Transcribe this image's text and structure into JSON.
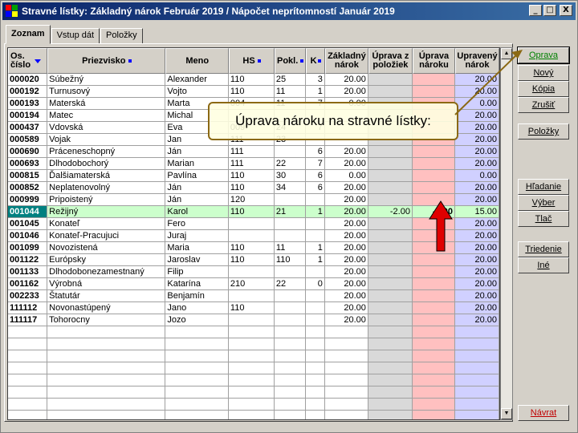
{
  "window": {
    "title": "Stravné lístky:  Základný nárok Február 2019  /  Nápočet neprítomností Január 2019",
    "min_label": "_",
    "max_label": "□",
    "close_label": "X"
  },
  "tabs": [
    {
      "label": "Zoznam",
      "active": true
    },
    {
      "label": "Vstup dát",
      "active": false
    },
    {
      "label": "Položky",
      "active": false
    }
  ],
  "columns": {
    "os_cislo": "Os. číslo",
    "priezvisko": "Priezvisko",
    "meno": "Meno",
    "hs": "HS",
    "pokl": "Pokl.",
    "k": "K",
    "zakladny_narok": "Základný nárok",
    "uprava_z_poloziek": "Úprava z položiek",
    "uprava_naroku": "Úprava nároku",
    "upraveny_narok": "Upravený nárok"
  },
  "rows": [
    {
      "code": "000020",
      "surname": "Súbežný",
      "name": "Alexander",
      "hs": "110",
      "pokl": "25",
      "k": "3",
      "base": "20.00",
      "adj_items": "",
      "adj": "",
      "final": "20.00"
    },
    {
      "code": "000192",
      "surname": "Turnusový",
      "name": "Vojto",
      "hs": "110",
      "pokl": "11",
      "k": "1",
      "base": "20.00",
      "adj_items": "",
      "adj": "",
      "final": "20.00"
    },
    {
      "code": "000193",
      "surname": "Materská",
      "name": "Marta",
      "hs": "004",
      "pokl": "11",
      "k": "7",
      "base": "0.00",
      "adj_items": "",
      "adj": "",
      "final": "0.00"
    },
    {
      "code": "000194",
      "surname": "Matec",
      "name": "Michal",
      "hs": "",
      "pokl": "",
      "k": "",
      "base": "",
      "adj_items": "",
      "adj": "",
      "final": "20.00"
    },
    {
      "code": "000437",
      "surname": "Vdovská",
      "name": "Eva",
      "hs": "009",
      "pokl": "24",
      "k": "7",
      "base": "",
      "adj_items": "",
      "adj": "",
      "final": "20.00"
    },
    {
      "code": "000589",
      "surname": "Vojak",
      "name": "Jan",
      "hs": "111",
      "pokl": "23",
      "k": "",
      "base": "",
      "adj_items": "",
      "adj": "",
      "final": "20.00"
    },
    {
      "code": "000690",
      "surname": "Práceneschopný",
      "name": "Ján",
      "hs": "111",
      "pokl": "",
      "k": "6",
      "base": "20.00",
      "adj_items": "",
      "adj": "",
      "final": "20.00"
    },
    {
      "code": "000693",
      "surname": "Dlhodobochorý",
      "name": "Marian",
      "hs": "111",
      "pokl": "22",
      "k": "7",
      "base": "20.00",
      "adj_items": "",
      "adj": "",
      "final": "20.00"
    },
    {
      "code": "000815",
      "surname": "Ďalšiamaterská",
      "name": "Pavlína",
      "hs": "110",
      "pokl": "30",
      "k": "6",
      "base": "0.00",
      "adj_items": "",
      "adj": "",
      "final": "0.00"
    },
    {
      "code": "000852",
      "surname": "Neplatenovolný",
      "name": "Ján",
      "hs": "110",
      "pokl": "34",
      "k": "6",
      "base": "20.00",
      "adj_items": "",
      "adj": "",
      "final": "20.00"
    },
    {
      "code": "000999",
      "surname": "Pripoistený",
      "name": "Ján",
      "hs": "120",
      "pokl": "",
      "k": "",
      "base": "20.00",
      "adj_items": "",
      "adj": "",
      "final": "20.00"
    },
    {
      "code": "001044",
      "surname": "Režijný",
      "name": "Karol",
      "hs": "110",
      "pokl": "21",
      "k": "1",
      "base": "20.00",
      "adj_items": "-2.00",
      "adj": "-3.00",
      "final": "15.00",
      "selected": true
    },
    {
      "code": "001045",
      "surname": "Konateľ",
      "name": "Fero",
      "hs": "",
      "pokl": "",
      "k": "",
      "base": "20.00",
      "adj_items": "",
      "adj": "",
      "final": "20.00"
    },
    {
      "code": "001046",
      "surname": "Konateľ-Pracujuci",
      "name": "Juraj",
      "hs": "",
      "pokl": "",
      "k": "",
      "base": "20.00",
      "adj_items": "",
      "adj": "",
      "final": "20.00"
    },
    {
      "code": "001099",
      "surname": "Novozistená",
      "name": "Maria",
      "hs": "110",
      "pokl": "11",
      "k": "1",
      "base": "20.00",
      "adj_items": "",
      "adj": "",
      "final": "20.00"
    },
    {
      "code": "001122",
      "surname": "Európsky",
      "name": "Jaroslav",
      "hs": "110",
      "pokl": "110",
      "k": "1",
      "base": "20.00",
      "adj_items": "",
      "adj": "",
      "final": "20.00"
    },
    {
      "code": "001133",
      "surname": "Dlhodobonezamestnaný",
      "name": "Filip",
      "hs": "",
      "pokl": "",
      "k": "",
      "base": "20.00",
      "adj_items": "",
      "adj": "",
      "final": "20.00"
    },
    {
      "code": "001162",
      "surname": "Výrobná",
      "name": "Katarína",
      "hs": "210",
      "pokl": "22",
      "k": "0",
      "base": "20.00",
      "adj_items": "",
      "adj": "",
      "final": "20.00"
    },
    {
      "code": "002233",
      "surname": "Štatutár",
      "name": "Benjamín",
      "hs": "",
      "pokl": "",
      "k": "",
      "base": "20.00",
      "adj_items": "",
      "adj": "",
      "final": "20.00"
    },
    {
      "code": "111112",
      "surname": "Novonastúpený",
      "name": "Jano",
      "hs": "110",
      "pokl": "",
      "k": "",
      "base": "20.00",
      "adj_items": "",
      "adj": "",
      "final": "20.00"
    },
    {
      "code": "111117",
      "surname": "Tohorocny",
      "name": "Jozo",
      "hs": "",
      "pokl": "",
      "k": "",
      "base": "20.00",
      "adj_items": "",
      "adj": "",
      "final": "20.00"
    }
  ],
  "empty_rows": 8,
  "buttons": {
    "oprava": "Oprava",
    "novy": "Nový",
    "kopia": "Kópia",
    "zrusit": "Zrušiť",
    "polozky": "Položky",
    "hladanie": "Hľadanie",
    "vyber": "Výber",
    "tlac": "Tlač",
    "triedenie": "Triedenie",
    "ine": "Iné",
    "navrat": "Návrat"
  },
  "callout": {
    "text": "Úprava nároku na stravné lístky:"
  },
  "colors": {
    "title_start": "#0a246a",
    "title_end": "#3a6ea5",
    "selected_row": "#ccffcc",
    "selected_code": "#008080",
    "gray_column": "#d9d9d9",
    "red_column": "#ffc0c0",
    "blue_column": "#d0d0ff",
    "annotation_arrow": "#e00000",
    "pointer_line": "#8b6914"
  }
}
